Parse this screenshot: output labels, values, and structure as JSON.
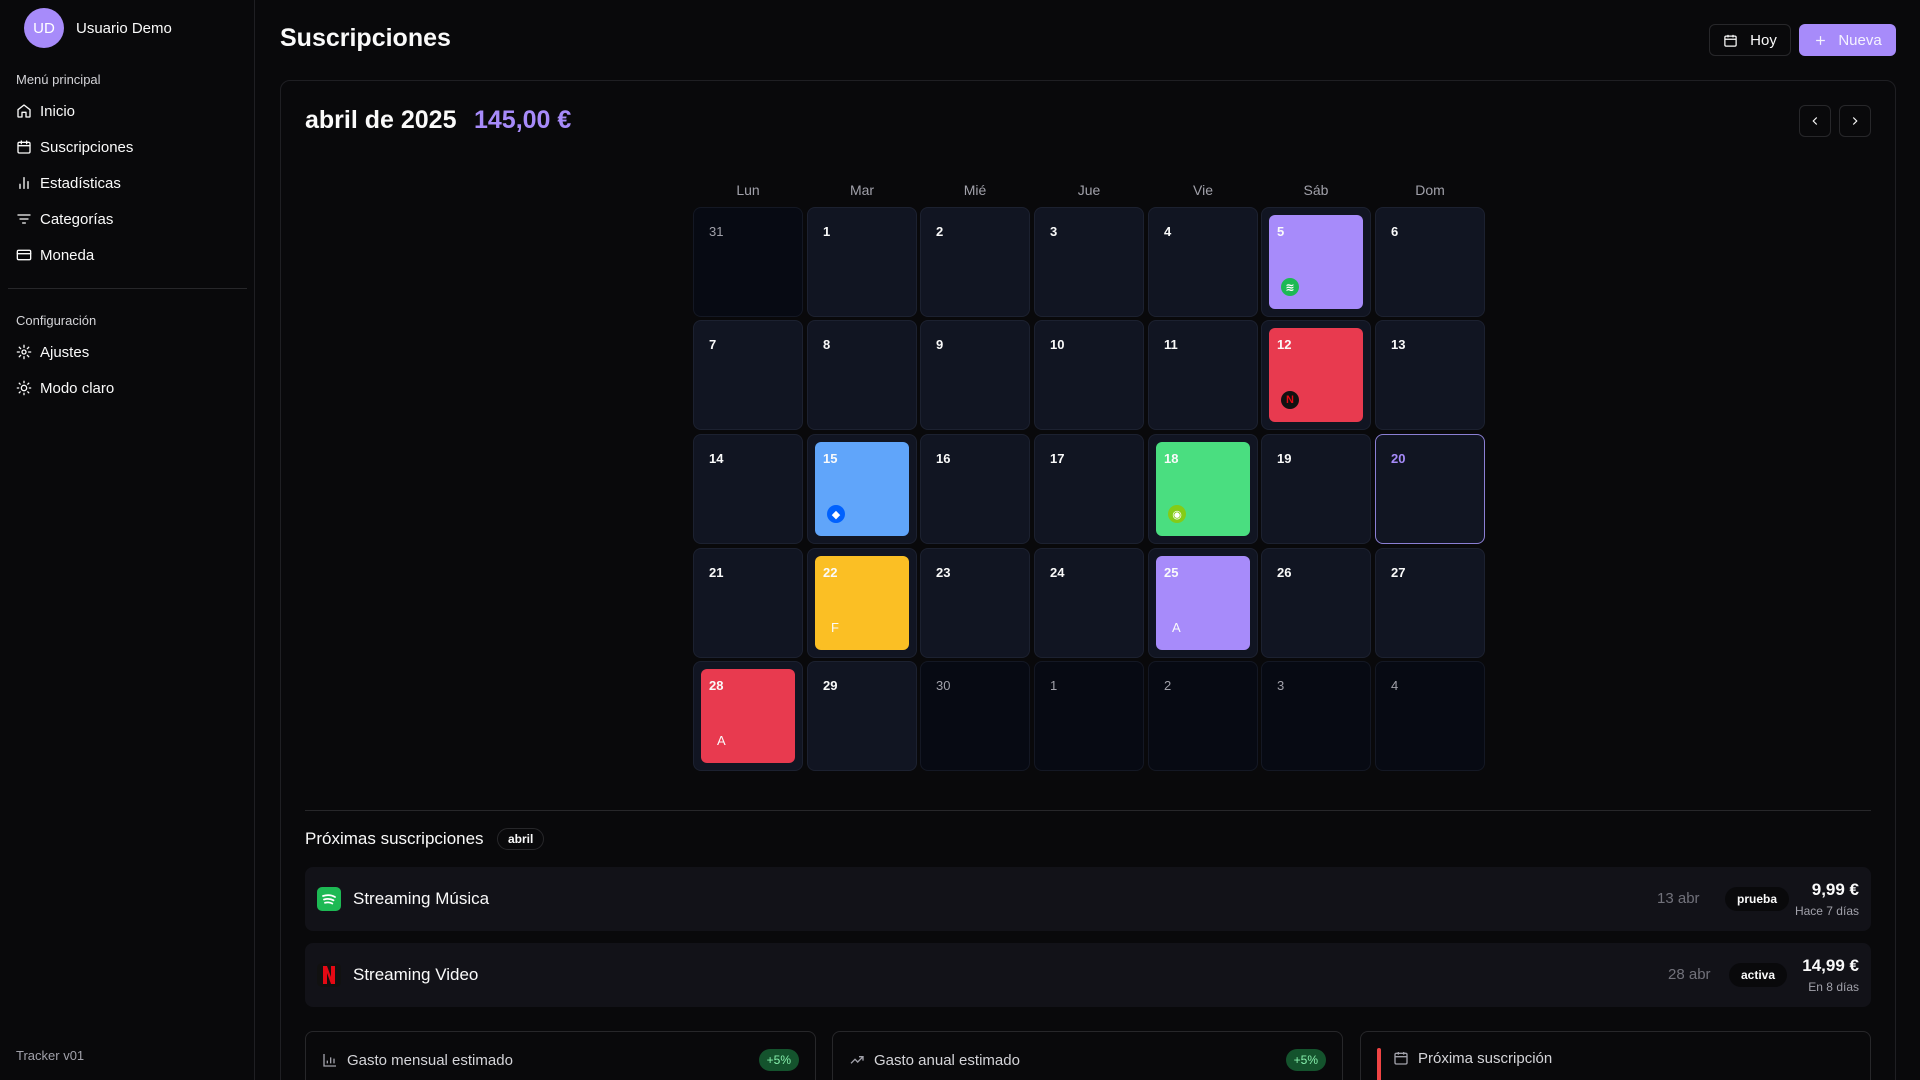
{
  "user": {
    "initials": "UD",
    "name": "Usuario Demo"
  },
  "sidebar": {
    "main_label": "Menú principal",
    "main_items": [
      {
        "label": "Inicio",
        "icon": "home-icon"
      },
      {
        "label": "Suscripciones",
        "icon": "calendar-icon"
      },
      {
        "label": "Estadísticas",
        "icon": "bar-chart-icon"
      },
      {
        "label": "Categorías",
        "icon": "filter-icon"
      },
      {
        "label": "Moneda",
        "icon": "credit-card-icon"
      }
    ],
    "config_label": "Configuración",
    "config_items": [
      {
        "label": "Ajustes",
        "icon": "gear-icon"
      },
      {
        "label": "Modo claro",
        "icon": "sun-icon"
      }
    ],
    "version": "Tracker v01"
  },
  "header": {
    "title": "Suscripciones",
    "today_label": "Hoy",
    "new_label": "Nueva"
  },
  "calendar": {
    "month_title": "abril de 2025",
    "total": "145,00 €",
    "weekdays": [
      "Lun",
      "Mar",
      "Mié",
      "Jue",
      "Vie",
      "Sáb",
      "Dom"
    ],
    "days": [
      "31",
      "1",
      "2",
      "3",
      "4",
      "5",
      "6",
      "7",
      "8",
      "9",
      "10",
      "11",
      "12",
      "13",
      "14",
      "15",
      "16",
      "17",
      "18",
      "19",
      "20",
      "21",
      "22",
      "23",
      "24",
      "25",
      "26",
      "27",
      "28",
      "29",
      "30",
      "1",
      "2",
      "3",
      "4"
    ],
    "events": [
      {
        "day": "5",
        "color": "#a78bfa",
        "icon": "spotify-icon"
      },
      {
        "day": "12",
        "color": "#e83a4f",
        "icon": "netflix-icon"
      },
      {
        "day": "15",
        "color": "#60a5fa",
        "icon": "dropbox-icon"
      },
      {
        "day": "18",
        "color": "#4ade80",
        "icon": "gamepad-icon"
      },
      {
        "day": "22",
        "color": "#fbbf24",
        "letter": "F"
      },
      {
        "day": "25",
        "color": "#a78bfa",
        "letter": "A"
      },
      {
        "day": "28",
        "color": "#e83a4f",
        "letter": "A"
      }
    ]
  },
  "upcoming": {
    "title": "Próximas suscripciones",
    "badge": "abril",
    "items": [
      {
        "name": "Streaming Música",
        "date": "13 abr",
        "status": "prueba",
        "price": "9,99 €",
        "relative": "Hace 7 días"
      },
      {
        "name": "Streaming Video",
        "date": "28 abr",
        "status": "activa",
        "price": "14,99 €",
        "relative": "En 8 días"
      }
    ]
  },
  "stats": [
    {
      "label": "Gasto mensual estimado",
      "chip": "+5%"
    },
    {
      "label": "Gasto anual estimado",
      "chip": "+5%"
    },
    {
      "label": "Próxima suscripción"
    }
  ],
  "colors": {
    "accent": "#a78bfa",
    "positive": "#86efac",
    "danger": "#ef4444"
  }
}
